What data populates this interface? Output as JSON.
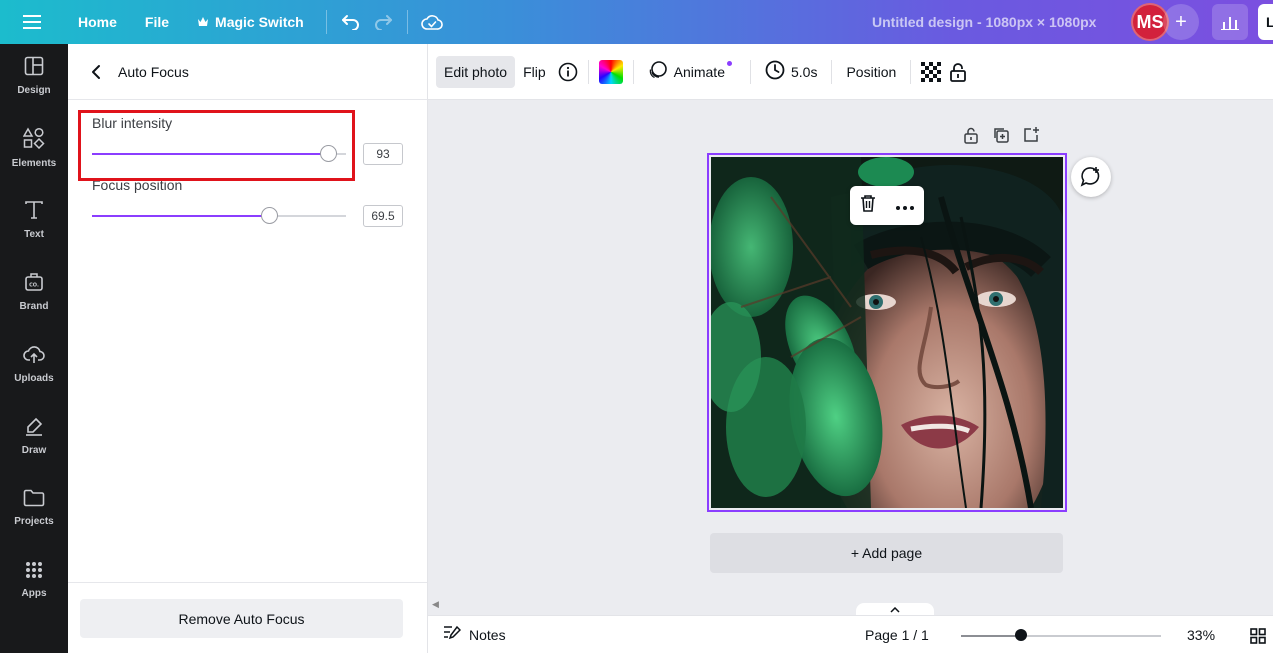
{
  "topbar": {
    "home": "Home",
    "file": "File",
    "magic_switch": "Magic Switch",
    "title": "Untitled design - 1080px × 1080px",
    "avatar_initials": "MS",
    "share_partial": "L"
  },
  "rail": [
    {
      "label": "Design",
      "icon": "layout-icon"
    },
    {
      "label": "Elements",
      "icon": "shapes-icon"
    },
    {
      "label": "Text",
      "icon": "text-icon"
    },
    {
      "label": "Brand",
      "icon": "brand-icon"
    },
    {
      "label": "Uploads",
      "icon": "cloud-upload-icon"
    },
    {
      "label": "Draw",
      "icon": "pen-icon"
    },
    {
      "label": "Projects",
      "icon": "folder-icon"
    },
    {
      "label": "Apps",
      "icon": "apps-grid-icon"
    }
  ],
  "panel": {
    "title": "Auto Focus",
    "blur": {
      "label": "Blur intensity",
      "value": "93",
      "fraction": 0.93
    },
    "focus": {
      "label": "Focus position",
      "value": "69.5",
      "fraction": 0.695
    },
    "remove_label": "Remove Auto Focus"
  },
  "toolbar": {
    "edit_photo": "Edit photo",
    "flip": "Flip",
    "animate": "Animate",
    "duration": "5.0s",
    "position": "Position"
  },
  "canvas": {
    "add_page": "+ Add page"
  },
  "bottombar": {
    "notes": "Notes",
    "page_info": "Page 1 / 1",
    "zoom": "33%",
    "zoom_fraction": 0.3
  },
  "colors": {
    "accent": "#8b3dff",
    "highlight": "#e0131b",
    "avatar": "#d2213c"
  }
}
